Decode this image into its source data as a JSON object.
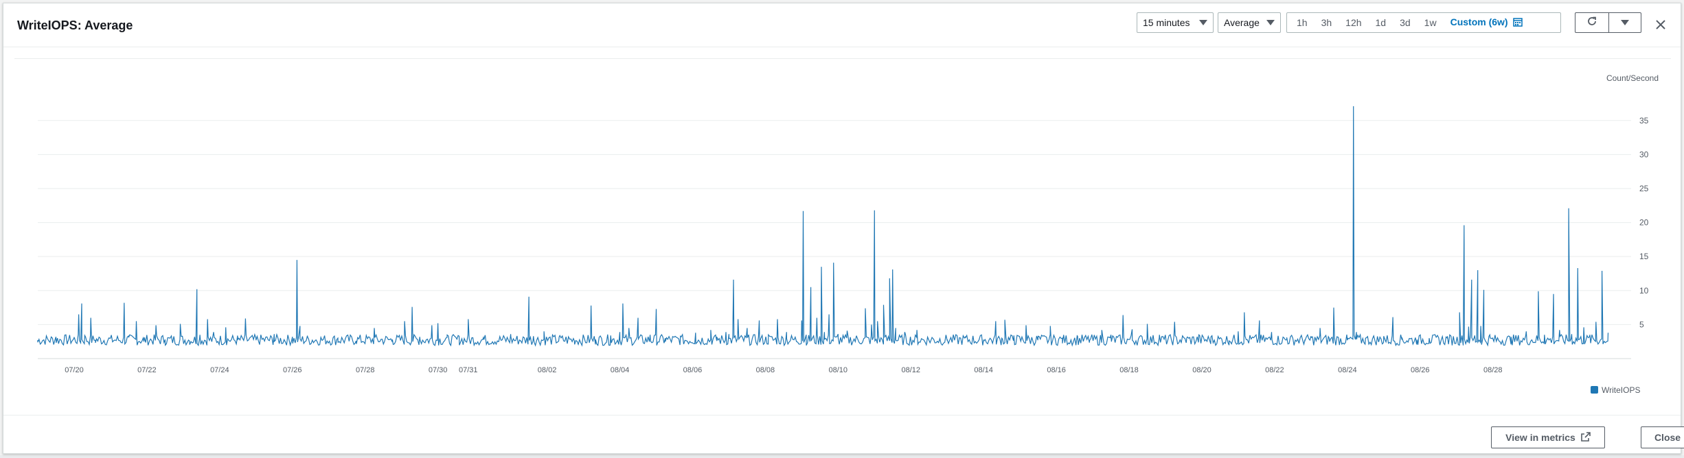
{
  "header": {
    "title": "WriteIOPS: Average",
    "period_select": "15 minutes",
    "stat_select": "Average",
    "ranges": [
      {
        "label": "1h",
        "active": false
      },
      {
        "label": "3h",
        "active": false
      },
      {
        "label": "12h",
        "active": false
      },
      {
        "label": "1d",
        "active": false
      },
      {
        "label": "3d",
        "active": false
      },
      {
        "label": "1w",
        "active": false
      },
      {
        "label": "Custom (6w)",
        "active": true
      }
    ],
    "icons": {
      "calendar": "calendar-icon",
      "refresh": "refresh-icon",
      "refresh_dropdown": "caret-down-icon",
      "close": "close-icon"
    }
  },
  "footer": {
    "view_in_metrics_label": "View in metrics",
    "close_label": "Close"
  },
  "colors": {
    "series": "#1f77b4",
    "accent": "#0073bb",
    "gridline": "#eaeded"
  },
  "chart_data": {
    "type": "line",
    "title": "",
    "xlabel": "",
    "ylabel": "Count/Second",
    "ylim": [
      0,
      38
    ],
    "yticks": [
      5,
      10,
      15,
      20,
      25,
      30,
      35
    ],
    "y_axis_side": "right",
    "xlim": [
      "07/19",
      "08/29"
    ],
    "xticks": [
      "07/20",
      "07/22",
      "07/24",
      "07/26",
      "07/28",
      "07/30",
      "07/31",
      "08/02",
      "08/04",
      "08/06",
      "08/08",
      "08/10",
      "08/12",
      "08/14",
      "08/16",
      "08/18",
      "08/20",
      "08/22",
      "08/24",
      "08/26",
      "08/28"
    ],
    "grid": true,
    "legend": "bottom-right",
    "series": [
      {
        "name": "WriteIOPS",
        "color": "#1f77b4",
        "baseline": 2.5,
        "points": [
          [
            "07/19 00:00",
            2.4
          ],
          [
            "07/19 12:00",
            3.2
          ],
          [
            "07/19 20:00",
            2.6
          ],
          [
            "07/20 00:00",
            3.1
          ],
          [
            "07/20 03:00",
            6.5
          ],
          [
            "07/20 05:00",
            8.1
          ],
          [
            "07/20 07:00",
            3.4
          ],
          [
            "07/20 11:00",
            6.0
          ],
          [
            "07/20 14:00",
            2.7
          ],
          [
            "07/21 00:00",
            3.0
          ],
          [
            "07/21 09:00",
            8.2
          ],
          [
            "07/21 12:00",
            3.1
          ],
          [
            "07/21 17:00",
            5.5
          ],
          [
            "07/21 22:00",
            2.5
          ],
          [
            "07/22 06:00",
            4.9
          ],
          [
            "07/22 12:00",
            2.8
          ],
          [
            "07/22 22:00",
            5.1
          ],
          [
            "07/23 04:00",
            2.6
          ],
          [
            "07/23 09:00",
            10.2
          ],
          [
            "07/23 11:00",
            3.5
          ],
          [
            "07/23 16:00",
            5.8
          ],
          [
            "07/23 20:00",
            3.9
          ],
          [
            "07/24 04:00",
            4.6
          ],
          [
            "07/24 12:00",
            2.8
          ],
          [
            "07/24 17:00",
            5.9
          ],
          [
            "07/25 00:00",
            2.7
          ],
          [
            "07/25 12:00",
            3.6
          ],
          [
            "07/26 00:00",
            3.2
          ],
          [
            "07/26 03:00",
            14.5
          ],
          [
            "07/26 05:00",
            4.8
          ],
          [
            "07/26 10:00",
            3.2
          ],
          [
            "07/27 06:00",
            3.0
          ],
          [
            "07/27 18:00",
            2.6
          ],
          [
            "07/28 06:00",
            4.5
          ],
          [
            "07/28 18:00",
            2.8
          ],
          [
            "07/29 02:00",
            5.5
          ],
          [
            "07/29 07:00",
            7.6
          ],
          [
            "07/29 12:00",
            3.2
          ],
          [
            "07/29 20:00",
            4.9
          ],
          [
            "07/30 00:00",
            5.2
          ],
          [
            "07/30 06:00",
            3.1
          ],
          [
            "07/30 14:00",
            3.3
          ],
          [
            "07/30 20:00",
            5.8
          ],
          [
            "07/31 06:00",
            3.1
          ],
          [
            "07/31 16:00",
            2.5
          ],
          [
            "08/01 00:00",
            3.6
          ],
          [
            "08/01 12:00",
            9.1
          ],
          [
            "08/01 15:00",
            3.3
          ],
          [
            "08/01 22:00",
            4.0
          ],
          [
            "08/02 08:00",
            3.2
          ],
          [
            "08/02 18:00",
            2.6
          ],
          [
            "08/03 05:00",
            7.8
          ],
          [
            "08/03 08:00",
            2.8
          ],
          [
            "08/03 18:00",
            3.4
          ],
          [
            "08/04 00:00",
            3.9
          ],
          [
            "08/04 02:00",
            8.1
          ],
          [
            "08/04 06:00",
            4.5
          ],
          [
            "08/04 12:00",
            6.0
          ],
          [
            "08/04 20:00",
            3.5
          ],
          [
            "08/05 00:00",
            7.3
          ],
          [
            "08/05 06:00",
            3.0
          ],
          [
            "08/05 16:00",
            3.3
          ],
          [
            "08/06 02:00",
            3.8
          ],
          [
            "08/06 12:00",
            4.2
          ],
          [
            "08/06 16:00",
            3.2
          ],
          [
            "08/06 22:00",
            3.9
          ],
          [
            "08/07 00:00",
            3.6
          ],
          [
            "08/07 03:00",
            11.6
          ],
          [
            "08/07 06:00",
            5.8
          ],
          [
            "08/07 12:00",
            4.5
          ],
          [
            "08/07 20:00",
            5.6
          ],
          [
            "08/08 02:00",
            3.5
          ],
          [
            "08/08 08:00",
            5.8
          ],
          [
            "08/08 14:00",
            3.9
          ],
          [
            "08/09 00:00",
            5.6
          ],
          [
            "08/09 01:00",
            21.7
          ],
          [
            "08/09 03:00",
            3.5
          ],
          [
            "08/09 06:00",
            10.5
          ],
          [
            "08/09 10:00",
            6.0
          ],
          [
            "08/09 13:00",
            13.5
          ],
          [
            "08/09 15:00",
            3.9
          ],
          [
            "08/09 18:00",
            6.5
          ],
          [
            "08/09 21:00",
            14.1
          ],
          [
            "08/10 00:00",
            3.6
          ],
          [
            "08/10 06:00",
            4.1
          ],
          [
            "08/10 12:00",
            3.3
          ],
          [
            "08/10 18:00",
            7.4
          ],
          [
            "08/10 22:00",
            5.0
          ],
          [
            "08/11 00:00",
            21.8
          ],
          [
            "08/11 02:00",
            5.5
          ],
          [
            "08/11 06:00",
            7.9
          ],
          [
            "08/11 10:00",
            11.8
          ],
          [
            "08/11 12:00",
            13.1
          ],
          [
            "08/11 14:00",
            4.5
          ],
          [
            "08/11 20:00",
            3.9
          ],
          [
            "08/12 04:00",
            4.2
          ],
          [
            "08/12 14:00",
            3.1
          ],
          [
            "08/13 00:00",
            2.8
          ],
          [
            "08/13 12:00",
            3.2
          ],
          [
            "08/14 00:00",
            2.7
          ],
          [
            "08/14 08:00",
            5.5
          ],
          [
            "08/14 12:00",
            3.0
          ],
          [
            "08/14 14:00",
            5.7
          ],
          [
            "08/14 20:00",
            3.4
          ],
          [
            "08/15 04:00",
            4.9
          ],
          [
            "08/15 12:00",
            3.3
          ],
          [
            "08/15 20:00",
            4.8
          ],
          [
            "08/16 04:00",
            3.0
          ],
          [
            "08/16 14:00",
            3.3
          ],
          [
            "08/16 22:00",
            2.7
          ],
          [
            "08/17 06:00",
            4.2
          ],
          [
            "08/17 12:00",
            3.5
          ],
          [
            "08/17 20:00",
            6.4
          ],
          [
            "08/18 02:00",
            4.3
          ],
          [
            "08/18 12:00",
            5.1
          ],
          [
            "08/18 20:00",
            3.5
          ],
          [
            "08/19 06:00",
            5.4
          ],
          [
            "08/19 14:00",
            3.0
          ],
          [
            "08/19 22:00",
            3.5
          ],
          [
            "08/20 06:00",
            3.2
          ],
          [
            "08/20 18:00",
            2.6
          ],
          [
            "08/21 00:00",
            4.0
          ],
          [
            "08/21 04:00",
            6.8
          ],
          [
            "08/21 08:00",
            3.2
          ],
          [
            "08/21 14:00",
            5.6
          ],
          [
            "08/21 22:00",
            3.9
          ],
          [
            "08/22 08:00",
            3.1
          ],
          [
            "08/22 20:00",
            2.8
          ],
          [
            "08/23 00:00",
            3.3
          ],
          [
            "08/23 06:00",
            4.5
          ],
          [
            "08/23 12:00",
            3.0
          ],
          [
            "08/23 15:00",
            7.5
          ],
          [
            "08/23 18:00",
            3.2
          ],
          [
            "08/24 00:00",
            2.7
          ],
          [
            "08/24 04:00",
            37.1
          ],
          [
            "08/24 06:00",
            3.9
          ],
          [
            "08/24 12:00",
            3.0
          ],
          [
            "08/25 00:00",
            3.3
          ],
          [
            "08/25 06:00",
            6.1
          ],
          [
            "08/25 12:00",
            3.1
          ],
          [
            "08/25 22:00",
            2.8
          ],
          [
            "08/26 06:00",
            3.0
          ],
          [
            "08/26 18:00",
            3.3
          ],
          [
            "08/27 02:00",
            6.8
          ],
          [
            "08/27 05:00",
            19.6
          ],
          [
            "08/27 08:00",
            4.7
          ],
          [
            "08/27 10:00",
            11.6
          ],
          [
            "08/27 12:00",
            3.4
          ],
          [
            "08/27 14:00",
            13.0
          ],
          [
            "08/27 16:00",
            4.8
          ],
          [
            "08/27 18:00",
            10.1
          ],
          [
            "08/27 22:00",
            3.5
          ],
          [
            "08/28 12:00",
            3.2
          ],
          [
            "08/28 22:00",
            4.0
          ],
          [
            "08/29 06:00",
            9.9
          ],
          [
            "08/29 10:00",
            3.5
          ],
          [
            "08/29 16:00",
            9.5
          ],
          [
            "08/29 20:00",
            4.2
          ],
          [
            "08/30 02:00",
            22.1
          ],
          [
            "08/30 04:00",
            3.6
          ],
          [
            "08/30 08:00",
            13.3
          ],
          [
            "08/30 12:00",
            4.6
          ],
          [
            "08/30 16:00",
            3.5
          ],
          [
            "08/30 20:00",
            5.4
          ],
          [
            "08/31 00:00",
            12.9
          ],
          [
            "08/31 04:00",
            3.8
          ]
        ]
      }
    ]
  }
}
